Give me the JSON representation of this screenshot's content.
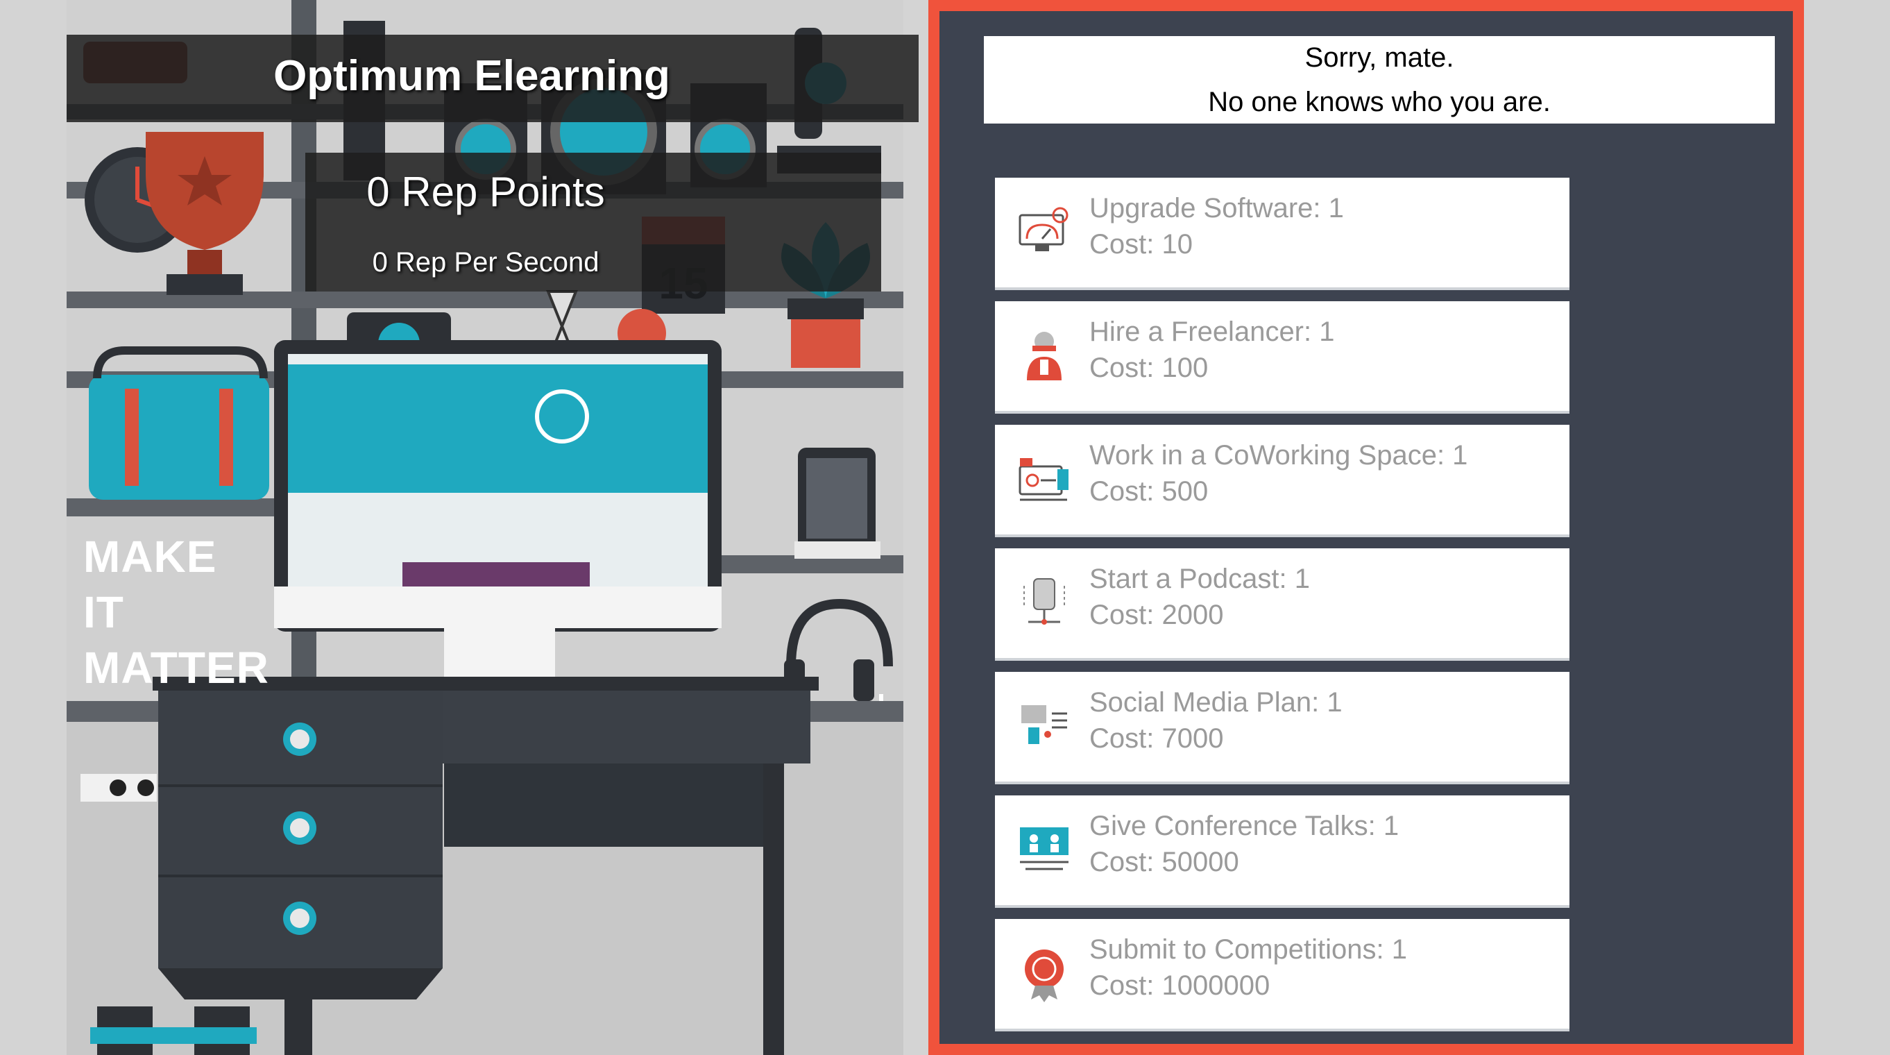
{
  "hud": {
    "title": "Optimum Elearning",
    "rep_points": "0 Rep Points",
    "rep_per_second": "0 Rep Per Second"
  },
  "scene": {
    "poster_lines": [
      "MAKE",
      "IT",
      "MATTER"
    ],
    "calendar_day": "15"
  },
  "message": {
    "line1": "Sorry, mate.",
    "line2": "No one knows who you are."
  },
  "upgrades": [
    {
      "name": "Upgrade Software: 1",
      "cost": "Cost: 10",
      "icon": "software-icon"
    },
    {
      "name": "Hire a Freelancer: 1",
      "cost": "Cost: 100",
      "icon": "freelancer-icon"
    },
    {
      "name": "Work in a CoWorking Space: 1",
      "cost": "Cost: 500",
      "icon": "coworking-icon"
    },
    {
      "name": "Start a Podcast: 1",
      "cost": "Cost: 2000",
      "icon": "podcast-icon"
    },
    {
      "name": "Social Media Plan: 1",
      "cost": "Cost: 7000",
      "icon": "social-media-icon"
    },
    {
      "name": "Give Conference Talks: 1",
      "cost": "Cost: 50000",
      "icon": "conference-icon"
    },
    {
      "name": "Submit to Competitions: 1",
      "cost": "Cost: 1000000",
      "icon": "award-icon"
    }
  ],
  "colors": {
    "panel_border": "#f0533c",
    "panel_bg": "#3d4350",
    "teal": "#1fa9bf",
    "scene_bg": "#d4d4d4"
  }
}
